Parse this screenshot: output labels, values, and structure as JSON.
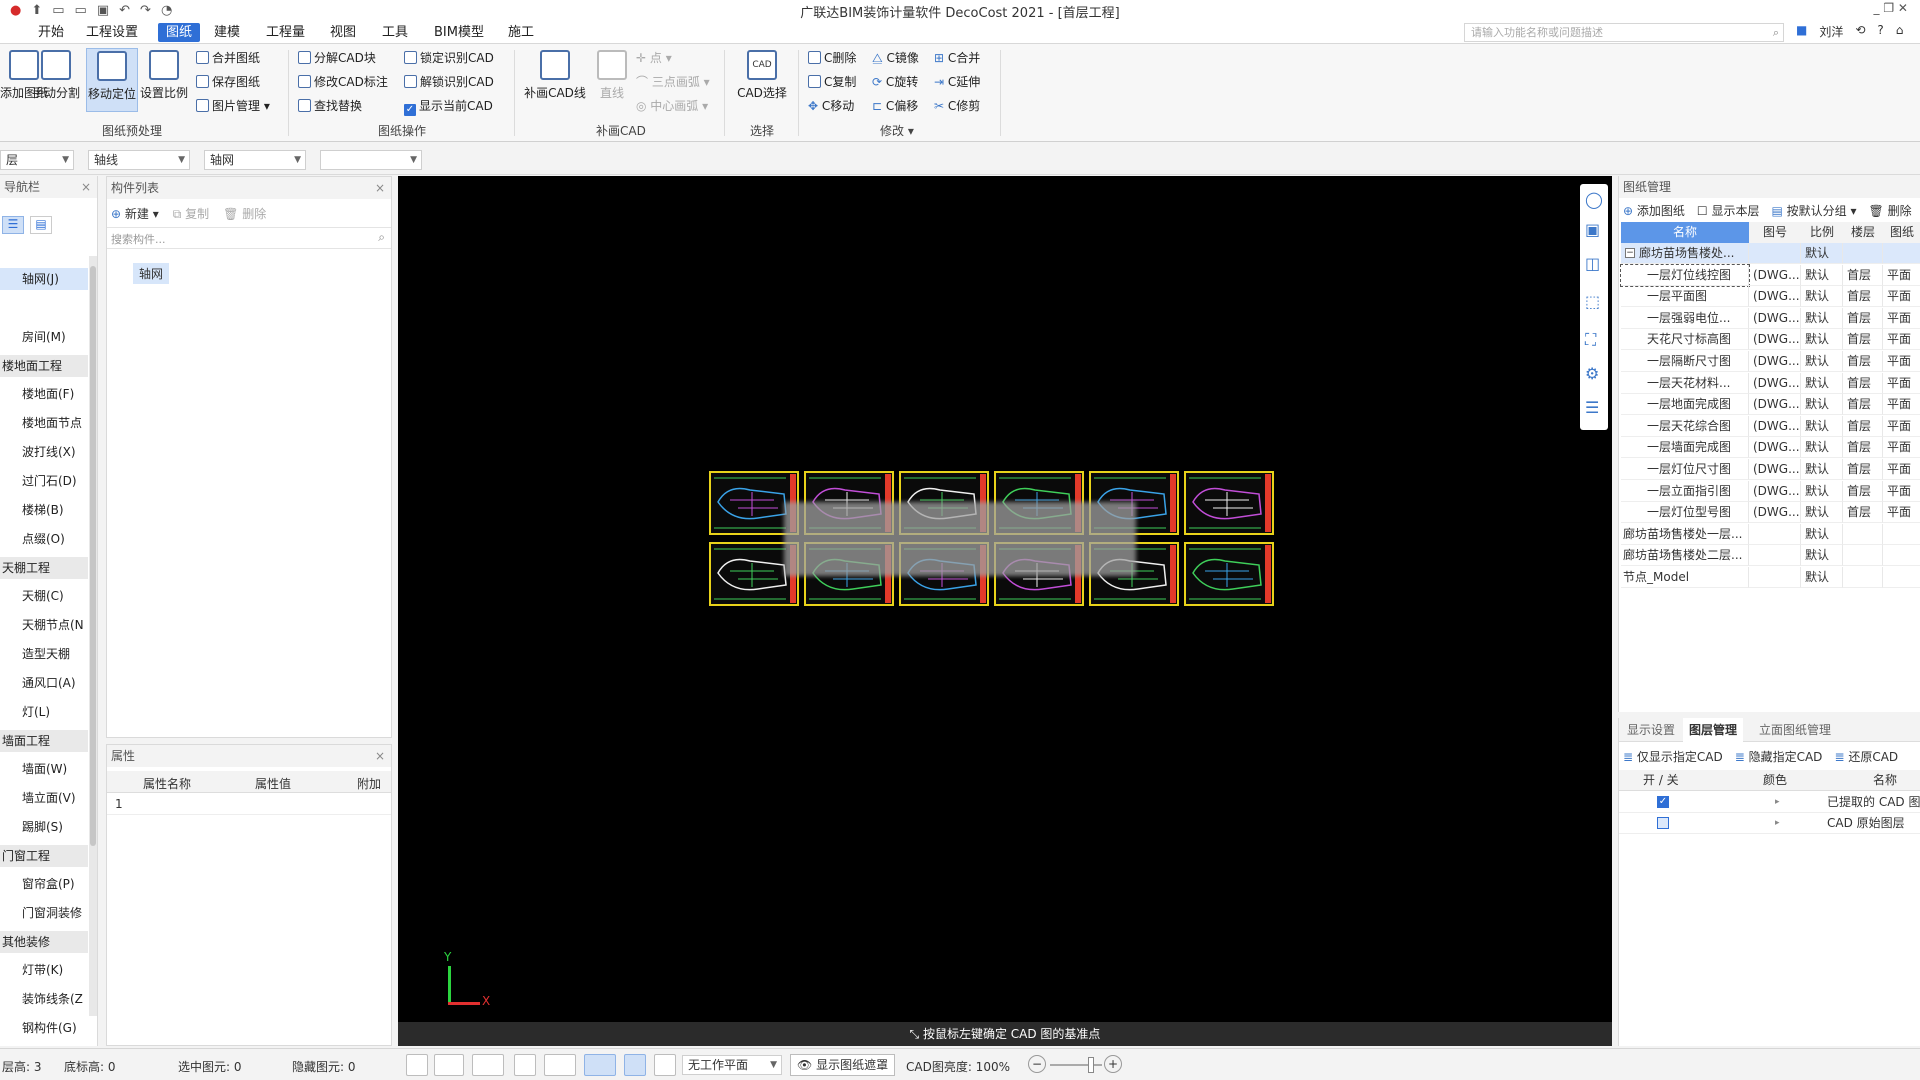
{
  "app": {
    "title": "广联达BIM装饰计量软件 DecoCost 2021 - [首层工程]",
    "window_buttons": "_  ❐  ✕"
  },
  "menu": {
    "tabs": [
      "开始",
      "工程设置",
      "图纸",
      "建模",
      "工程量",
      "视图",
      "工具",
      "BIM模型",
      "施工"
    ],
    "active": "图纸",
    "search_placeholder": "请输入功能名称或问题描述",
    "user": "刘洋",
    "help": "?"
  },
  "ribbon": {
    "preprocess": {
      "big": [
        "添加图纸",
        "手动分割",
        "移动定位",
        "设置比例"
      ],
      "small": [
        "合并图纸",
        "保存图纸",
        "图片管理"
      ],
      "label": "图纸预处理"
    },
    "drawing_ops": {
      "col1": [
        "分解CAD块",
        "修改CAD标注",
        "查找替换"
      ],
      "col2": [
        "锁定识别CAD",
        "解锁识别CAD",
        "显示当前CAD"
      ],
      "label": "图纸操作"
    },
    "supplement": {
      "big": [
        "补画CAD线",
        "直线"
      ],
      "small": [
        "点",
        "三点画弧",
        "中心画弧"
      ],
      "label": "补画CAD"
    },
    "select": {
      "big": "CAD选择",
      "label": "选择"
    },
    "modify": {
      "col1": [
        "C删除",
        "C复制",
        "C移动"
      ],
      "col2": [
        "C镜像",
        "C旋转",
        "C偏移"
      ],
      "col3": [
        "C合并",
        "C延伸",
        "C修剪"
      ],
      "label": "修改"
    }
  },
  "filterbar": {
    "combo1": "层",
    "combo2": "轴线",
    "combo3": "轴网",
    "combo4": ""
  },
  "leftnav": {
    "header": "导航栏",
    "items": [
      {
        "type": "item",
        "label": "轴网(J)",
        "selected": true
      },
      {
        "type": "item",
        "label": "房间(M)"
      },
      {
        "type": "section",
        "label": "楼地面工程"
      },
      {
        "type": "item",
        "label": "楼地面(F)"
      },
      {
        "type": "item",
        "label": "楼地面节点"
      },
      {
        "type": "item",
        "label": "波打线(X)"
      },
      {
        "type": "item",
        "label": "过门石(D)"
      },
      {
        "type": "item",
        "label": "楼梯(B)"
      },
      {
        "type": "item",
        "label": "点缀(O)"
      },
      {
        "type": "section",
        "label": "天棚工程"
      },
      {
        "type": "item",
        "label": "天棚(C)"
      },
      {
        "type": "item",
        "label": "天棚节点(N"
      },
      {
        "type": "item",
        "label": "造型天棚"
      },
      {
        "type": "item",
        "label": "通风口(A)"
      },
      {
        "type": "item",
        "label": "灯(L)"
      },
      {
        "type": "section",
        "label": "墙面工程"
      },
      {
        "type": "item",
        "label": "墙面(W)"
      },
      {
        "type": "item",
        "label": "墙立面(V)"
      },
      {
        "type": "item",
        "label": "踢脚(S)"
      },
      {
        "type": "section",
        "label": "门窗工程"
      },
      {
        "type": "item",
        "label": "窗帘盒(P)"
      },
      {
        "type": "item",
        "label": "门窗洞装修"
      },
      {
        "type": "section",
        "label": "其他装修"
      },
      {
        "type": "item",
        "label": "灯带(K)"
      },
      {
        "type": "item",
        "label": "装饰线条(Z"
      },
      {
        "type": "item",
        "label": "钢构件(G)"
      }
    ]
  },
  "complist": {
    "header": "构件列表",
    "new": "新建",
    "copy": "复制",
    "delete": "删除",
    "search_placeholder": "搜索构件...",
    "items": [
      "轴网"
    ]
  },
  "props": {
    "header": "属性",
    "columns": [
      "属性名称",
      "属性值",
      "附加"
    ],
    "rows": [
      {
        "no": "1",
        "name": "",
        "value": "",
        "extra": ""
      }
    ]
  },
  "canvas": {
    "hint": "按鼠标左键确定 CAD 图的基准点",
    "axis_x": "X",
    "axis_y": "Y",
    "sheet_colors": [
      "#e8d21a",
      "#e33a2a",
      "#3aa3e8",
      "#c24ed8",
      "#f0f0f0",
      "#3fcf5a"
    ]
  },
  "drawing_mgr": {
    "header": "图纸管理",
    "toolbar": [
      "添加图纸",
      "显示本层",
      "按默认分组",
      "删除"
    ],
    "columns": [
      "名称",
      "图号",
      "比例",
      "楼层",
      "图纸"
    ],
    "rows": [
      {
        "level": 0,
        "name": "廊坊苗场售楼处...",
        "no": "",
        "scale": "默认",
        "floor": "",
        "type": "",
        "group": true
      },
      {
        "level": 1,
        "name": "一层灯位线控图",
        "no": "(DWG...",
        "scale": "默认",
        "floor": "首层",
        "type": "平面",
        "selected": true
      },
      {
        "level": 1,
        "name": "一层平面图",
        "no": "(DWG...",
        "scale": "默认",
        "floor": "首层",
        "type": "平面"
      },
      {
        "level": 1,
        "name": "一层强弱电位...",
        "no": "(DWG...",
        "scale": "默认",
        "floor": "首层",
        "type": "平面"
      },
      {
        "level": 1,
        "name": "天花尺寸标高图",
        "no": "(DWG...",
        "scale": "默认",
        "floor": "首层",
        "type": "平面"
      },
      {
        "level": 1,
        "name": "一层隔断尺寸图",
        "no": "(DWG...",
        "scale": "默认",
        "floor": "首层",
        "type": "平面"
      },
      {
        "level": 1,
        "name": "一层天花材料...",
        "no": "(DWG...",
        "scale": "默认",
        "floor": "首层",
        "type": "平面"
      },
      {
        "level": 1,
        "name": "一层地面完成图",
        "no": "(DWG...",
        "scale": "默认",
        "floor": "首层",
        "type": "平面"
      },
      {
        "level": 1,
        "name": "一层天花综合图",
        "no": "(DWG...",
        "scale": "默认",
        "floor": "首层",
        "type": "平面"
      },
      {
        "level": 1,
        "name": "一层墙面完成图",
        "no": "(DWG...",
        "scale": "默认",
        "floor": "首层",
        "type": "平面"
      },
      {
        "level": 1,
        "name": "一层灯位尺寸图",
        "no": "(DWG...",
        "scale": "默认",
        "floor": "首层",
        "type": "平面"
      },
      {
        "level": 1,
        "name": "一层立面指引图",
        "no": "(DWG...",
        "scale": "默认",
        "floor": "首层",
        "type": "平面"
      },
      {
        "level": 1,
        "name": "一层灯位型号图",
        "no": "(DWG...",
        "scale": "默认",
        "floor": "首层",
        "type": "平面"
      },
      {
        "level": 0,
        "name": "廊坊苗场售楼处一层...",
        "no": "",
        "scale": "默认",
        "floor": "",
        "type": ""
      },
      {
        "level": 0,
        "name": "廊坊苗场售楼处二层...",
        "no": "",
        "scale": "默认",
        "floor": "",
        "type": ""
      },
      {
        "level": 0,
        "name": "节点_Model",
        "no": "",
        "scale": "默认",
        "floor": "",
        "type": ""
      }
    ]
  },
  "layer_mgr": {
    "tabs": [
      "显示设置",
      "图层管理",
      "立面图纸管理"
    ],
    "active": "图层管理",
    "toolbar": [
      "仅显示指定CAD",
      "隐藏指定CAD",
      "还原CAD"
    ],
    "columns": [
      "开 / 关",
      "颜色",
      "名称"
    ],
    "rows": [
      {
        "on": true,
        "name": "已提取的 CAD 图层"
      },
      {
        "on": false,
        "name": "CAD 原始图层"
      }
    ]
  },
  "status": {
    "floor": "层高: 3",
    "base": "底标高: 0",
    "selected": "选中图元: 0",
    "hidden": "隐藏图元: 0",
    "workplane": "无工作平面",
    "show_mask": "显示图纸遮罩",
    "brightness": "CAD图亮度: 100%"
  }
}
